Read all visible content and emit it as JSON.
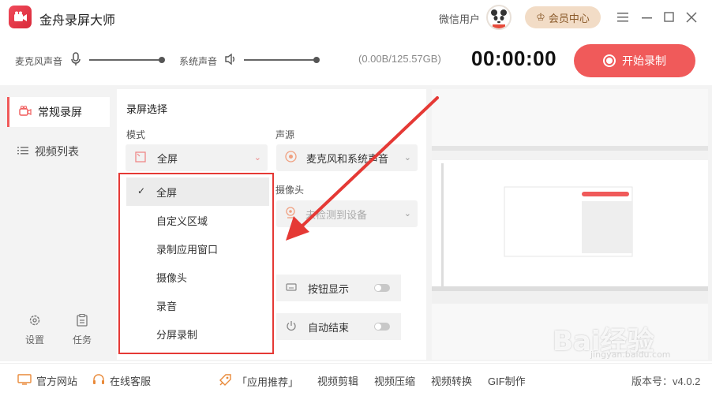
{
  "app": {
    "title": "金舟录屏大师",
    "user": "微信用户",
    "vip_label": "会员中心"
  },
  "audio": {
    "mic_label": "麦克风声音",
    "system_label": "系统声音",
    "storage": "(0.00B/125.57GB)",
    "timer": "00:00:00",
    "record_label": "开始录制"
  },
  "sidebar": {
    "items": [
      {
        "label": "常规录屏"
      },
      {
        "label": "视频列表"
      }
    ],
    "settings_label": "设置",
    "tasks_label": "任务"
  },
  "panel": {
    "section_title": "录屏选择",
    "mode_label": "模式",
    "mode_value": "全屏",
    "source_label": "声源",
    "source_value": "麦克风和系统声音",
    "camera_label": "摄像头",
    "camera_value": "未检测到设备",
    "toggle1_label": "按钮显示",
    "toggle2_label": "自动结束"
  },
  "dropdown": {
    "options": [
      "全屏",
      "自定义区域",
      "录制应用窗口",
      "摄像头",
      "录音",
      "分屏录制"
    ],
    "selected": "全屏"
  },
  "footer": {
    "website": "官方网站",
    "service": "在线客服",
    "recommend": "「应用推荐」",
    "edit": "视频剪辑",
    "compress": "视频压缩",
    "convert": "视频转换",
    "gif": "GIF制作",
    "version": "版本号：v4.0.2"
  },
  "watermark": {
    "main": "Bai经验",
    "sub": "jingyan.baidu.com"
  },
  "colors": {
    "accent": "#f05a5a",
    "annotation": "#e53935",
    "vip": "#f2dcc6"
  }
}
